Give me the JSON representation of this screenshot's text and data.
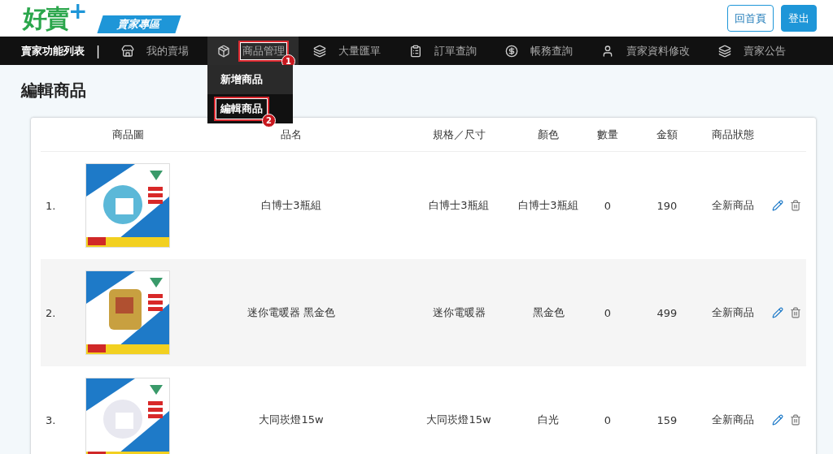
{
  "header": {
    "logo": "好賣",
    "logo_plus": "+",
    "badge": "賣家專區",
    "buttons": [
      {
        "label": "回首頁",
        "kind": "outline"
      },
      {
        "label": "登出",
        "kind": "primary"
      }
    ]
  },
  "nav": {
    "title": "賣家功能列表",
    "separator": "|",
    "items": [
      {
        "label": "我的賣場",
        "kind": "store",
        "expanded": false
      },
      {
        "label": "商品管理",
        "kind": "box",
        "expanded": true,
        "callout": "1",
        "menu": [
          {
            "label": "新增商品",
            "selected": false
          },
          {
            "label": "編輯商品",
            "selected": true,
            "callout": "2"
          }
        ]
      },
      {
        "label": "大量匯單",
        "kind": "layers",
        "expanded": false
      },
      {
        "label": "訂單查詢",
        "kind": "clipboard",
        "expanded": false
      },
      {
        "label": "帳務查詢",
        "kind": "dollar",
        "expanded": false
      },
      {
        "label": "賣家資料修改",
        "kind": "user",
        "expanded": false
      },
      {
        "label": "賣家公告",
        "kind": "layers",
        "expanded": false
      }
    ]
  },
  "page_title": "編輯商品",
  "table": {
    "columns": [
      "商品圖",
      "品名",
      "規格／尺寸",
      "顏色",
      "數量",
      "金額",
      "商品狀態"
    ],
    "rows": [
      {
        "index": "1.",
        "name": "白博士3瓶組",
        "spec": "白博士3瓶組",
        "color_name": "白博士3瓶組",
        "qty": "0",
        "price": "190",
        "status": "全新商品"
      },
      {
        "index": "2.",
        "name": "迷你電暖器 黑金色",
        "spec": "迷你電暖器",
        "color_name": "黑金色",
        "qty": "0",
        "price": "499",
        "status": "全新商品"
      },
      {
        "index": "3.",
        "name": "大同崁燈15w",
        "spec": "大同崁燈15w",
        "color_name": "白光",
        "qty": "0",
        "price": "159",
        "status": "全新商品"
      }
    ]
  }
}
